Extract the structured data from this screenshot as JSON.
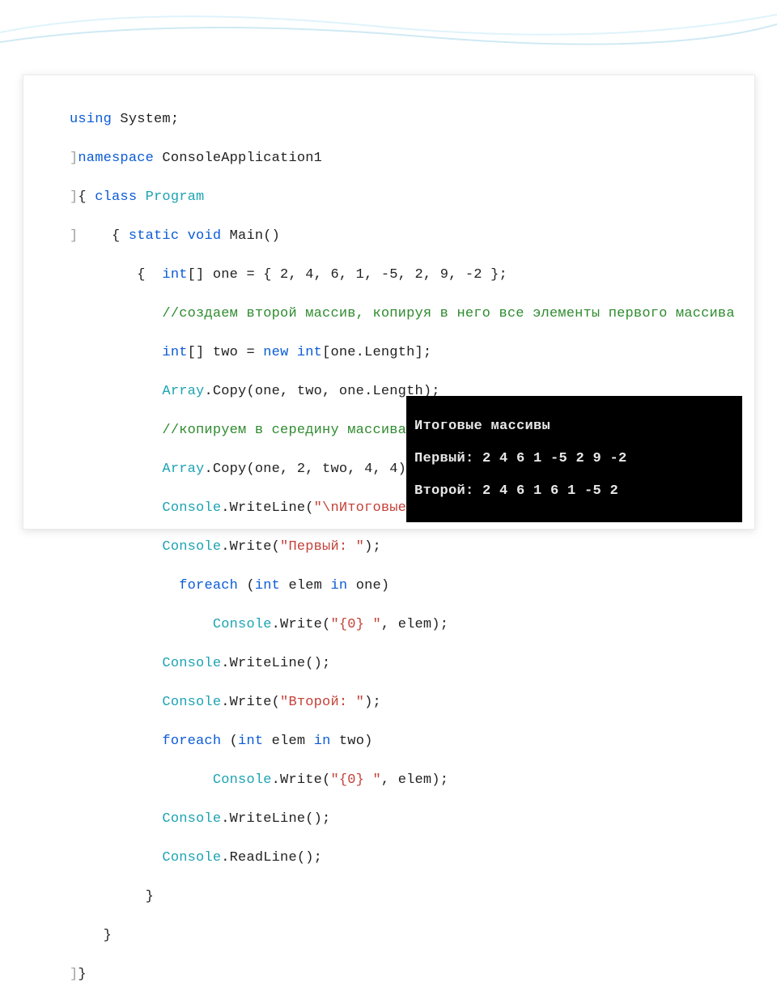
{
  "swoosh": {
    "color1": "#dff3fb",
    "color2": "#cfe9f4"
  },
  "code": {
    "l1": {
      "k": "using",
      "t": " System;"
    },
    "l2": {
      "g": "]",
      "k": "namespace",
      "t": " ConsoleApplication1"
    },
    "l3": {
      "g": "]",
      "t1": "{",
      "k": " class ",
      "typ": "Program"
    },
    "l4": {
      "g": "]",
      "t1": "    { ",
      "k": "static void",
      "t2": " Main()"
    },
    "l5": {
      "t1": "        {  ",
      "k": "int",
      "t2": "[] one = { 2, 4, 6, 1, -5, 2, 9, -2 };"
    },
    "l6": {
      "pad": "           ",
      "cmt": "//создаем второй массив, копируя в него все элементы первого массива"
    },
    "l7": {
      "pad": "           ",
      "k": "int",
      "t1": "[] two = ",
      "k2": "new int",
      "t2": "[one.Length];"
    },
    "l8": {
      "pad": "           ",
      "typ": "Array",
      "t": ".Copy(one, two, one.Length);"
    },
    "l9": {
      "pad": "           ",
      "cmt": "//копируем в середину массива two фрагмент массива one"
    },
    "l10": {
      "pad": "           ",
      "typ": "Array",
      "t": ".Copy(one, 2, two, 4, 4);"
    },
    "l11": {
      "pad": "           ",
      "typ": "Console",
      "t1": ".WriteLine(",
      "s": "\"\\nИтоговые массивы \"",
      "t2": ");"
    },
    "l12": {
      "pad": "           ",
      "typ": "Console",
      "t1": ".Write(",
      "s": "\"Первый: \"",
      "t2": ");"
    },
    "l13": {
      "pad": "             ",
      "k": "foreach",
      "t1": " (",
      "k2": "int",
      "t2": " elem ",
      "k3": "in",
      "t3": " one)"
    },
    "l14": {
      "pad": "                 ",
      "typ": "Console",
      "t1": ".Write(",
      "s": "\"{0} \"",
      "t2": ", elem);"
    },
    "l15": {
      "pad": "           ",
      "typ": "Console",
      "t": ".WriteLine();"
    },
    "l16": {
      "pad": "           ",
      "typ": "Console",
      "t1": ".Write(",
      "s": "\"Второй: \"",
      "t2": ");"
    },
    "l17": {
      "pad": "           ",
      "k": "foreach",
      "t1": " (",
      "k2": "int",
      "t2": " elem ",
      "k3": "in",
      "t3": " two)"
    },
    "l18": {
      "pad": "                 ",
      "typ": "Console",
      "t1": ".Write(",
      "s": "\"{0} \"",
      "t2": ", elem);"
    },
    "l19": {
      "pad": "           ",
      "typ": "Console",
      "t": ".WriteLine();"
    },
    "l20": {
      "pad": "           ",
      "typ": "Console",
      "t": ".ReadLine();"
    },
    "l21": {
      "t": "         }"
    },
    "l22": {
      "t": "    }"
    },
    "l23": {
      "g": "]",
      "t": "}"
    }
  },
  "console": {
    "line1": "Итоговые массивы",
    "line2": "Первый: 2 4 6 1 -5 2 9 -2",
    "line3": "Второй: 2 4 6 1 6 1 -5 2"
  }
}
